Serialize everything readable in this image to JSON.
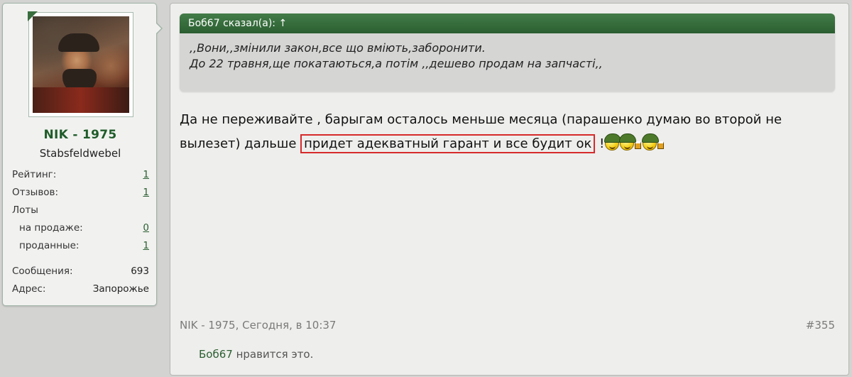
{
  "user": {
    "name": "NIK - 1975",
    "title": "Stabsfeldwebel",
    "stats": [
      {
        "key": "Рейтинг:",
        "value": "1",
        "link": true
      },
      {
        "key": "Отзывов:",
        "value": "1",
        "link": true
      },
      {
        "key": "Лоты",
        "value": "",
        "link": false
      },
      {
        "key": "на продаже:",
        "value": "0",
        "link": true,
        "sub": true
      },
      {
        "key": "проданные:",
        "value": "1",
        "link": true,
        "sub": true
      },
      {
        "key": "Сообщения:",
        "value": "693",
        "link": false
      },
      {
        "key": "Адрес:",
        "value": "Запорожье",
        "link": false
      }
    ]
  },
  "quote": {
    "header": "Боб67 сказал(а): ↑",
    "lines": [
      ",,Вони,,змінили закон,все що вміють,заборонити.",
      "До 22 травня,ще покатаються,а потім ,,дешево продам на запчасті,,"
    ]
  },
  "message": {
    "text_before": "Да не переживайте , барыгам осталось меньше месяца (парашенко думаю во второй не вылезет) дальше ",
    "highlighted": "придет адекватный гарант и все будит ок",
    "text_after": " !"
  },
  "meta": {
    "author_date": "NIK - 1975, Сегодня, в 10:37",
    "post_number": "#355"
  },
  "likes": {
    "who": "Боб67",
    "text": " нравится это."
  },
  "colors": {
    "accent": "#2b5e31",
    "highlight_border": "#d62a2a"
  }
}
